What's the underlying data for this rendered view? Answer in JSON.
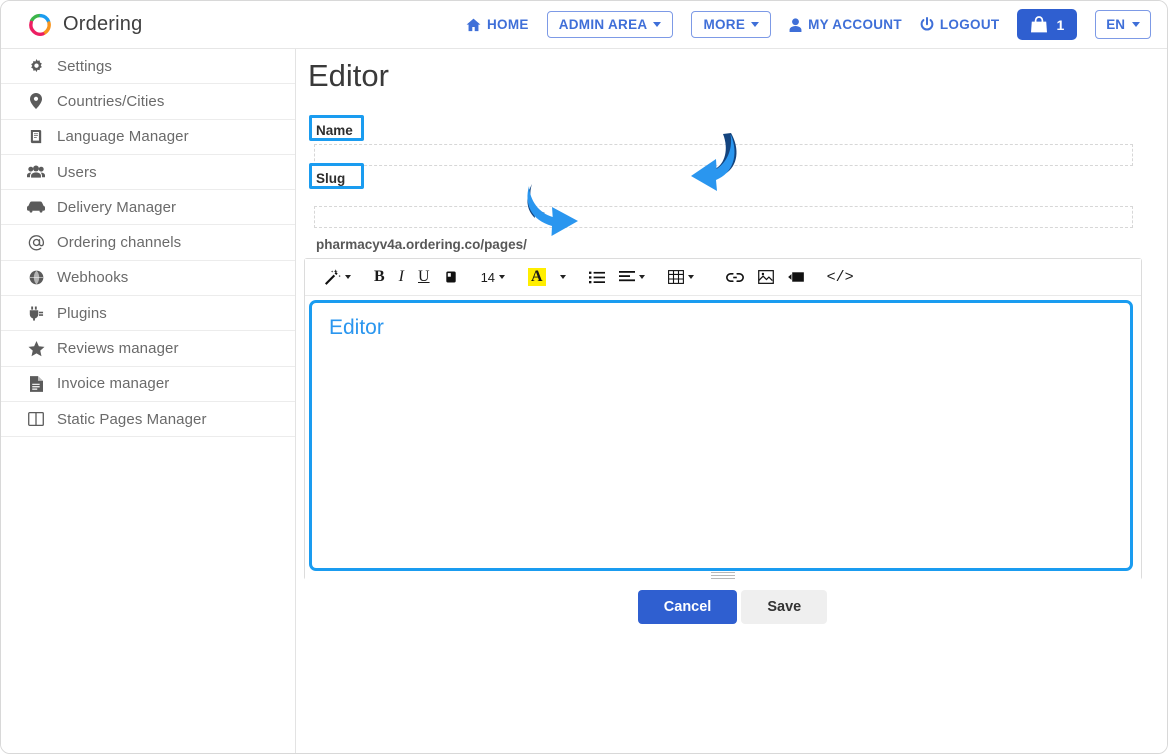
{
  "brand": {
    "name": "Ordering",
    "logo_icon": "ordering-ring-logo"
  },
  "topnav": {
    "home": {
      "label": "HOME",
      "icon": "home-icon"
    },
    "admin_area": {
      "label": "ADMIN AREA",
      "icon": "chevron-down-icon"
    },
    "more": {
      "label": "MORE",
      "icon": "chevron-down-icon"
    },
    "my_account": {
      "label": "MY ACCOUNT",
      "icon": "user-icon"
    },
    "logout": {
      "label": "LOGOUT",
      "icon": "power-icon"
    },
    "cart": {
      "count": "1",
      "icon": "shopping-bag-icon"
    },
    "language": {
      "label": "EN",
      "icon": "chevron-down-icon"
    }
  },
  "sidebar": {
    "items": [
      {
        "label": "Settings",
        "icon": "gear-icon"
      },
      {
        "label": "Countries/Cities",
        "icon": "map-pin-icon"
      },
      {
        "label": "Language Manager",
        "icon": "book-language-icon"
      },
      {
        "label": "Users",
        "icon": "users-group-icon"
      },
      {
        "label": "Delivery Manager",
        "icon": "car-icon"
      },
      {
        "label": "Ordering channels",
        "icon": "at-sign-icon"
      },
      {
        "label": "Webhooks",
        "icon": "globe-icon"
      },
      {
        "label": "Plugins",
        "icon": "plug-icon"
      },
      {
        "label": "Reviews manager",
        "icon": "star-icon"
      },
      {
        "label": "Invoice manager",
        "icon": "file-text-icon"
      },
      {
        "label": "Static Pages Manager",
        "icon": "columns-icon"
      }
    ]
  },
  "main": {
    "title": "Editor",
    "name_field": {
      "label": "Name",
      "value": "",
      "placeholder": ""
    },
    "slug_field": {
      "label": "Slug",
      "prefix": "pharmacyv4a.ordering.co/pages/",
      "value": "",
      "placeholder": ""
    },
    "editor": {
      "content": "Editor",
      "toolbar": [
        {
          "name": "magic-wand-icon",
          "label": "",
          "caret": true
        },
        {
          "name": "bold-button",
          "label": "B",
          "caret": false
        },
        {
          "name": "italic-button",
          "label": "I",
          "caret": false
        },
        {
          "name": "underline-button",
          "label": "U",
          "caret": false
        },
        {
          "name": "clear-format-icon",
          "label": "",
          "caret": false
        },
        {
          "name": "font-size-select",
          "label": "14",
          "caret": true
        },
        {
          "name": "text-color-button",
          "label": "A",
          "caret": true
        },
        {
          "name": "unordered-list-icon",
          "label": "",
          "caret": false
        },
        {
          "name": "align-icon",
          "label": "",
          "caret": true
        },
        {
          "name": "table-icon",
          "label": "",
          "caret": true
        },
        {
          "name": "link-icon",
          "label": "",
          "caret": false
        },
        {
          "name": "image-icon",
          "label": "",
          "caret": false
        },
        {
          "name": "video-icon",
          "label": "",
          "caret": false
        },
        {
          "name": "code-view-button",
          "label": "</>",
          "caret": false
        }
      ]
    },
    "cancel_label": "Cancel",
    "save_label": "Save"
  },
  "colors": {
    "accent_blue": "#2f5fd0",
    "link_blue": "#3f6fd8",
    "annotation_blue": "#1a9cf0",
    "annotation_dark": "#14447e",
    "highlight_yellow": "#ffee00"
  }
}
